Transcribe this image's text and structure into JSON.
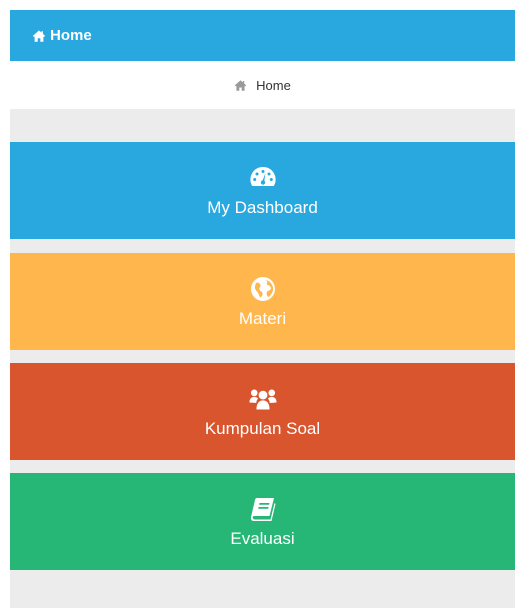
{
  "header": {
    "title": "Home",
    "icon": "home-icon",
    "background": "#29a8e0"
  },
  "breadcrumb": {
    "label": "Home",
    "icon": "home-icon"
  },
  "tiles": [
    {
      "label": "My Dashboard",
      "icon": "dashboard-gauge-icon",
      "color": "#29a8e0"
    },
    {
      "label": "Materi",
      "icon": "globe-icon",
      "color": "#ffb64c"
    },
    {
      "label": "Kumpulan Soal",
      "icon": "users-group-icon",
      "color": "#d9552e"
    },
    {
      "label": "Evaluasi",
      "icon": "book-icon",
      "color": "#26b776"
    }
  ]
}
